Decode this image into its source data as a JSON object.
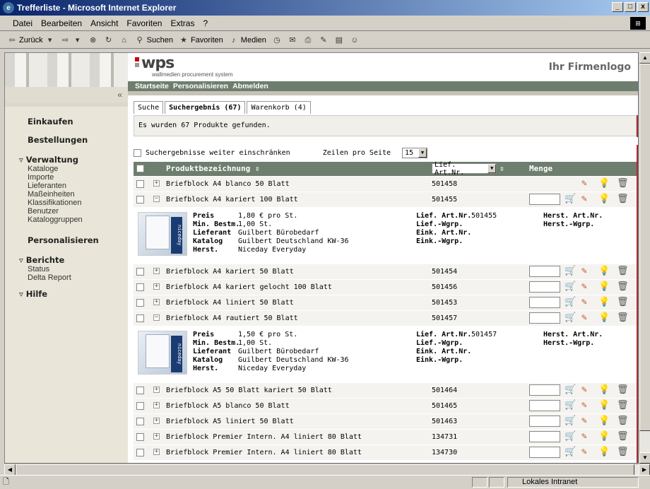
{
  "window": {
    "title": "Trefferliste - Microsoft Internet Explorer",
    "controls": [
      "_",
      "□",
      "x"
    ]
  },
  "menu": [
    "Datei",
    "Bearbeiten",
    "Ansicht",
    "Favoriten",
    "Extras",
    "?"
  ],
  "toolbar": {
    "back": "Zurück",
    "search": "Suchen",
    "favorites": "Favoriten",
    "media": "Medien"
  },
  "status": {
    "zone": "Lokales Intranet"
  },
  "sidebar": {
    "collapse": "«",
    "einkaufen": "Einkaufen",
    "bestellungen": "Bestellungen",
    "verwaltung": "Verwaltung",
    "verwaltung_items": [
      "Kataloge",
      "Importe",
      "Lieferanten",
      "Maßeinheiten",
      "Klassifikationen",
      "Benutzer",
      "Kataloggruppen"
    ],
    "personalisieren": "Personalisieren",
    "berichte": "Berichte",
    "berichte_items": [
      "Status",
      "Delta Report"
    ],
    "hilfe": "Hilfe"
  },
  "header": {
    "logo_text": "wps",
    "logo_sub": "wallmedien procurement system",
    "firm_logo": "Ihr Firmenlogo",
    "nav": [
      "Startseite",
      "Personalisieren",
      "Abmelden"
    ]
  },
  "tabs": [
    "Suche",
    "Suchergebnis (67)",
    "Warenkorb (4)"
  ],
  "message": "Es wurden 67 Produkte gefunden.",
  "filter": {
    "restrict_label": "Suchergebnisse weiter einschränken",
    "rows_label": "Zeilen pro Seite",
    "rows_value": "15"
  },
  "table": {
    "col_name": "Produktbezeichnung",
    "col_art_select": "Lief. Art.Nr.",
    "col_qty": "Menge",
    "rows": [
      {
        "name": "Briefblock A4 blanco 50 Blatt",
        "art": "501458",
        "expanded": false,
        "qty_field": false
      },
      {
        "name": "Briefblock A4 kariert 100 Blatt",
        "art": "501455",
        "expanded": true,
        "qty_field": true
      },
      {
        "name": "Briefblock A4 kariert 50 Blatt",
        "art": "501454",
        "expanded": false,
        "qty_field": true
      },
      {
        "name": "Briefblock A4 kariert gelocht 100 Blatt",
        "art": "501456",
        "expanded": false,
        "qty_field": true
      },
      {
        "name": "Briefblock A4 liniert 50 Blatt",
        "art": "501453",
        "expanded": false,
        "qty_field": true
      },
      {
        "name": "Briefblock A4 rautiert 50 Blatt",
        "art": "501457",
        "expanded": true,
        "qty_field": true
      },
      {
        "name": "Briefblock A5 50 Blatt kariert 50 Blatt",
        "art": "501464",
        "expanded": false,
        "qty_field": true
      },
      {
        "name": "Briefblock A5 blanco 50 Blatt",
        "art": "501465",
        "expanded": false,
        "qty_field": true
      },
      {
        "name": "Briefblock A5 liniert 50 Blatt",
        "art": "501463",
        "expanded": false,
        "qty_field": true
      },
      {
        "name": "Briefblock Premier Intern. A4 liniert 80 Blatt",
        "art": "134731",
        "expanded": false,
        "qty_field": true
      },
      {
        "name": "Briefblock Premier Intern. A4 liniert 80 Blatt",
        "art": "134730",
        "expanded": false,
        "qty_field": true
      }
    ],
    "details": [
      {
        "preis": "1,80 € pro St.",
        "min": "1,00 St.",
        "lieferant": "Guilbert Bürobedarf",
        "katalog": "Guilbert Deutschland KW-36",
        "herst": "Niceday Everyday",
        "lief_art": "501455"
      },
      {
        "preis": "1,50 € pro St.",
        "min": "1,00 St.",
        "lieferant": "Guilbert Bürobedarf",
        "katalog": "Guilbert Deutschland KW-36",
        "herst": "Niceday Everyday",
        "lief_art": "501457"
      }
    ],
    "detail_labels": {
      "preis": "Preis",
      "min": "Min. Bestm.",
      "lieferant": "Lieferant",
      "katalog": "Katalog",
      "herst": "Herst.",
      "lief_art": "Lief. Art.Nr.",
      "lief_wgrp": "Lief.-Wgrp.",
      "eink_art": "Eink. Art.Nr.",
      "eink_wgrp": "Eink.-Wgrp.",
      "herst_art": "Herst. Art.Nr.",
      "herst_wgrp": "Herst.-Wgrp."
    },
    "image_brand": "niceday"
  }
}
